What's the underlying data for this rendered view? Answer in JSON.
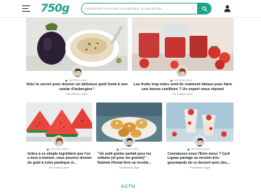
{
  "header": {
    "logo": "750g",
    "search_placeholder": "Rechercher une recette, un ingrédient, un type de plat...",
    "icons": {
      "menu": "hamburger-menu-icon",
      "search": "search-icon",
      "account": "user-icon"
    }
  },
  "cards": [
    {
      "date": "14/07/2024 à 8h00",
      "title": "Voici le secret pour donner un délicieux goût fumé à son caviar d'aubergine !",
      "author": "Par Mélanie Guillot"
    },
    {
      "date": "14/07/2024 à 8h00",
      "title": "Les fruits trop mûrs sont-ils vraiment idéaux pour faire une bonne confiture ? Un expert nous répond",
      "author": "Par Cristina Lièvre"
    },
    {
      "date": "14/07/2024 à 6h00",
      "title": "Grâce à ce simple ingrédient que l'on a tous à maison, vous pourrez donner du goût à votre pastèque si...",
      "author": "Par Cristina Lièvre"
    },
    {
      "date": "14/07/2024 à 6h00",
      "title": "\"Un petit goûter parfait pour les enfants (et pour les grands)\" : Noémie Honiat livre sa recette...",
      "author": "Par Béatrice Vigot"
    },
    {
      "date": "14/07/2024 à 6h00",
      "title": "Connaissez-vous l'Eton mess ? Cyril Lignac partage sa version très gourmande de ce dessert avec des...",
      "author": "Par Béatrice Vigot"
    }
  ],
  "section_label": "ACTU",
  "colors": {
    "brand": "#1aa58a"
  }
}
